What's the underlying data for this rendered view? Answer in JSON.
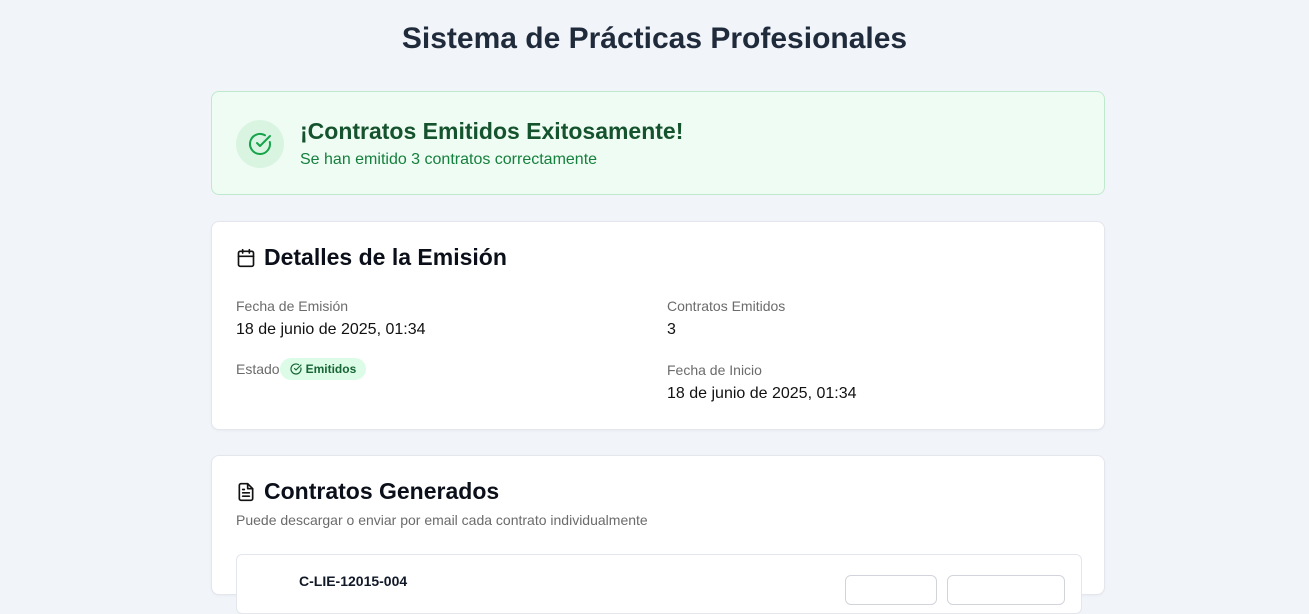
{
  "page": {
    "title": "Sistema de Prácticas Profesionales"
  },
  "success": {
    "title": "¡Contratos Emitidos Exitosamente!",
    "subtitle": "Se han emitido 3 contratos correctamente",
    "icon": "check-circle-icon"
  },
  "details": {
    "title": "Detalles de la Emisión",
    "icon": "calendar-icon",
    "fecha_emision_label": "Fecha de Emisión",
    "fecha_emision_value": "18 de junio de 2025, 01:34",
    "contratos_emitidos_label": "Contratos Emitidos",
    "contratos_emitidos_value": "3",
    "estado_label": "Estado",
    "estado_badge": "Emitidos",
    "fecha_inicio_label": "Fecha de Inicio",
    "fecha_inicio_value": "18 de junio de 2025, 01:34"
  },
  "contracts": {
    "title": "Contratos Generados",
    "icon": "document-icon",
    "description": "Puede descargar o enviar por email cada contrato individualmente",
    "items": [
      {
        "code": "C-LIE-12015-004"
      }
    ]
  },
  "colors": {
    "background": "#f1f4f9",
    "success_bg": "#effcf3",
    "success_border": "#bfe9cc",
    "success_title": "#14532d",
    "success_text": "#15803d",
    "badge_bg": "#dcfce7",
    "badge_text": "#166534"
  }
}
